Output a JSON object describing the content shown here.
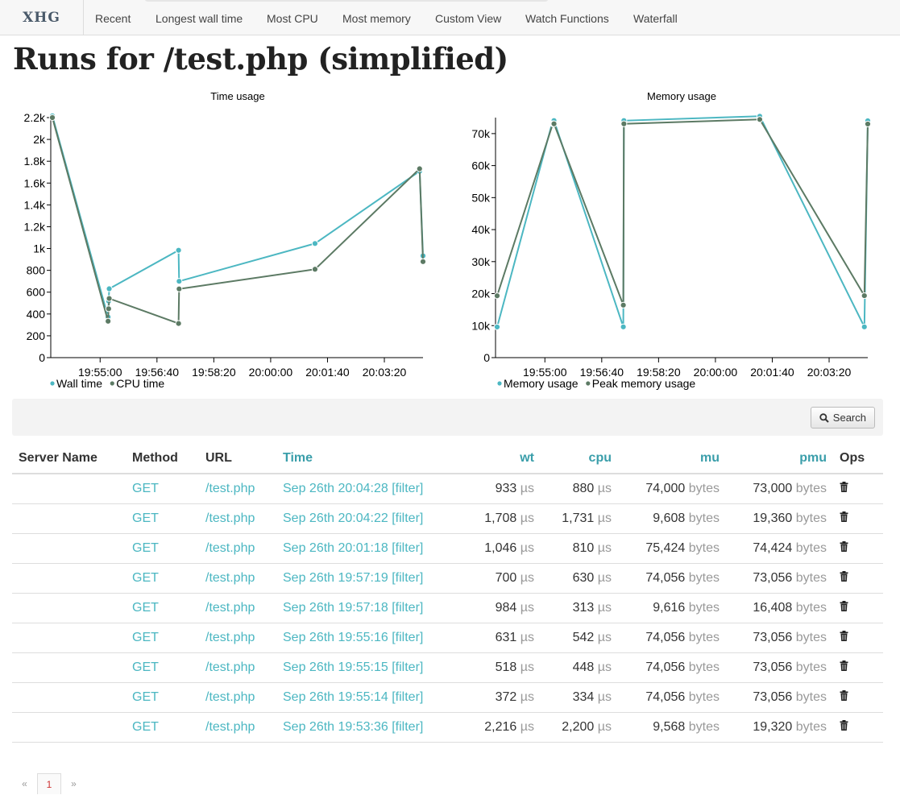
{
  "nav": {
    "brand": "XHG",
    "items": [
      {
        "label": "Recent"
      },
      {
        "label": "Longest wall time"
      },
      {
        "label": "Most CPU"
      },
      {
        "label": "Most memory"
      },
      {
        "label": "Custom View"
      },
      {
        "label": "Watch Functions"
      },
      {
        "label": "Waterfall"
      }
    ]
  },
  "page_title": "Runs for /test.php (simplified)",
  "chart_data": [
    {
      "type": "line",
      "title": "Time usage",
      "x_ticks": [
        "19:55:00",
        "19:56:40",
        "19:58:20",
        "20:00:00",
        "20:01:40",
        "20:03:20"
      ],
      "ylim": [
        0,
        2200
      ],
      "y_ticks": [
        "0",
        "200",
        "400",
        "600",
        "800",
        "1k",
        "1.2k",
        "1.4k",
        "1.6k",
        "1.8k",
        "2k",
        "2.2k"
      ],
      "x": [
        "19:53:36",
        "19:55:14",
        "19:55:15",
        "19:55:16",
        "19:57:18",
        "19:57:19",
        "20:01:18",
        "20:04:22",
        "20:04:28"
      ],
      "series": [
        {
          "name": "Wall time",
          "color": "#4cb7c2",
          "values": [
            2216,
            372,
            518,
            631,
            984,
            700,
            1046,
            1708,
            933
          ]
        },
        {
          "name": "CPU time",
          "color": "#5c7a64",
          "values": [
            2200,
            334,
            448,
            542,
            313,
            630,
            810,
            1731,
            880
          ]
        }
      ],
      "legend": "bottom-left"
    },
    {
      "type": "line",
      "title": "Memory usage",
      "x_ticks": [
        "19:55:00",
        "19:56:40",
        "19:58:20",
        "20:00:00",
        "20:01:40",
        "20:03:20"
      ],
      "ylim": [
        0,
        75000
      ],
      "y_ticks": [
        "0",
        "10k",
        "20k",
        "30k",
        "40k",
        "50k",
        "60k",
        "70k"
      ],
      "x": [
        "19:53:36",
        "19:55:14",
        "19:55:15",
        "19:55:16",
        "19:57:18",
        "19:57:19",
        "20:01:18",
        "20:04:22",
        "20:04:28"
      ],
      "series": [
        {
          "name": "Memory usage",
          "color": "#4cb7c2",
          "values": [
            9568,
            74056,
            74056,
            74056,
            9616,
            74056,
            75424,
            9608,
            74000
          ]
        },
        {
          "name": "Peak memory usage",
          "color": "#5c7a64",
          "values": [
            19320,
            73056,
            73056,
            73056,
            16408,
            73056,
            74424,
            19360,
            73000
          ]
        }
      ],
      "legend": "bottom-left"
    }
  ],
  "search": {
    "label": "Search"
  },
  "table": {
    "headers": {
      "server": "Server Name",
      "method": "Method",
      "url": "URL",
      "time": "Time",
      "wt": "wt",
      "cpu": "cpu",
      "mu": "mu",
      "pmu": "pmu",
      "ops": "Ops"
    },
    "units": {
      "time": "µs",
      "mem": "bytes"
    },
    "filter_label": "[filter]",
    "rows": [
      {
        "server": "",
        "method": "GET",
        "url": "/test.php",
        "time": "Sep 26th 20:04:28",
        "wt": "933",
        "cpu": "880",
        "mu": "74,000",
        "pmu": "73,000"
      },
      {
        "server": "",
        "method": "GET",
        "url": "/test.php",
        "time": "Sep 26th 20:04:22",
        "wt": "1,708",
        "cpu": "1,731",
        "mu": "9,608",
        "pmu": "19,360"
      },
      {
        "server": "",
        "method": "GET",
        "url": "/test.php",
        "time": "Sep 26th 20:01:18",
        "wt": "1,046",
        "cpu": "810",
        "mu": "75,424",
        "pmu": "74,424"
      },
      {
        "server": "",
        "method": "GET",
        "url": "/test.php",
        "time": "Sep 26th 19:57:19",
        "wt": "700",
        "cpu": "630",
        "mu": "74,056",
        "pmu": "73,056"
      },
      {
        "server": "",
        "method": "GET",
        "url": "/test.php",
        "time": "Sep 26th 19:57:18",
        "wt": "984",
        "cpu": "313",
        "mu": "9,616",
        "pmu": "16,408"
      },
      {
        "server": "",
        "method": "GET",
        "url": "/test.php",
        "time": "Sep 26th 19:55:16",
        "wt": "631",
        "cpu": "542",
        "mu": "74,056",
        "pmu": "73,056"
      },
      {
        "server": "",
        "method": "GET",
        "url": "/test.php",
        "time": "Sep 26th 19:55:15",
        "wt": "518",
        "cpu": "448",
        "mu": "74,056",
        "pmu": "73,056"
      },
      {
        "server": "",
        "method": "GET",
        "url": "/test.php",
        "time": "Sep 26th 19:55:14",
        "wt": "372",
        "cpu": "334",
        "mu": "74,056",
        "pmu": "73,056"
      },
      {
        "server": "",
        "method": "GET",
        "url": "/test.php",
        "time": "Sep 26th 19:53:36",
        "wt": "2,216",
        "cpu": "2,200",
        "mu": "9,568",
        "pmu": "19,320"
      }
    ]
  },
  "pagination": {
    "prev": "«",
    "current": "1",
    "next": "»"
  },
  "icons": {
    "search": "search-icon",
    "delete": "trash-icon"
  }
}
